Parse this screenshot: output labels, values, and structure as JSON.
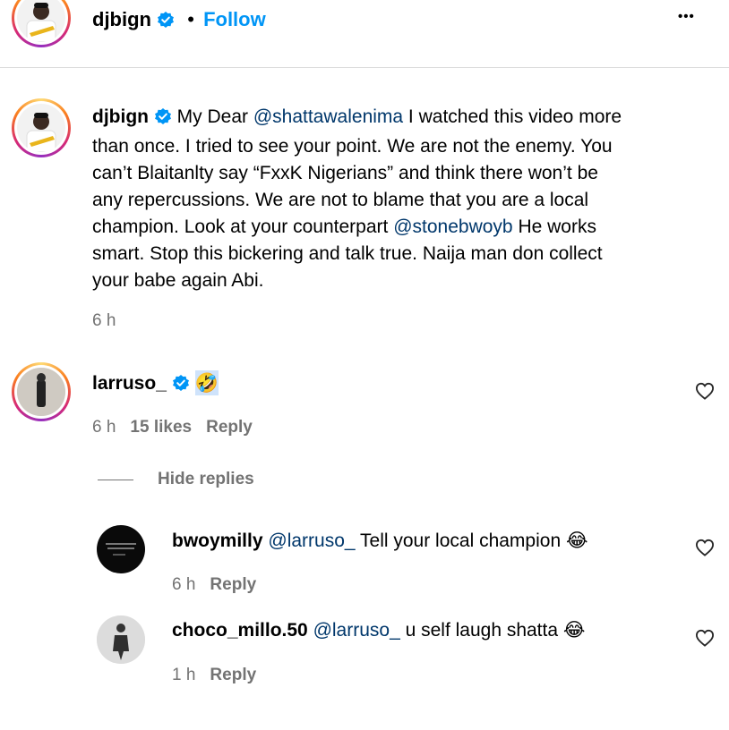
{
  "header": {
    "username": "djbign",
    "separator": "•",
    "follow_label": "Follow",
    "more_label": "•••"
  },
  "caption": {
    "username": "djbign",
    "lines": [
      [
        "My Dear ",
        "@shattawalenima",
        " I watched this video more"
      ],
      [
        "than once. I tried to see your point. We are not the enemy. You"
      ],
      [
        "can’t Blaitanlty say “FxxK Nigerians” and think there won’t be"
      ],
      [
        "any repercussions. We are not to blame that you are a local"
      ],
      [
        "champion. Look at your counterpart ",
        "@stonebwoyb",
        " He works"
      ],
      [
        "smart. Stop this bickering and talk true. Naija man don collect"
      ],
      [
        "your babe again Abi."
      ]
    ],
    "mention_1": "@shattawalenima",
    "mention_2": "@stonebwoyb",
    "time": "6 h"
  },
  "comment": {
    "username": "larruso_",
    "emoji": "🤣",
    "time": "6 h",
    "likes": "15 likes",
    "reply_label": "Reply",
    "hide_replies_label": "Hide replies"
  },
  "replies": [
    {
      "username": "bwoymilly",
      "mention": "@larruso_",
      "text": " Tell your local champion ",
      "emoji": "😂",
      "time": "6 h",
      "reply_label": "Reply"
    },
    {
      "username": "choco_millo.50",
      "mention": "@larruso_",
      "text": " u self laugh shatta ",
      "emoji": "😂",
      "time": "1 h",
      "reply_label": "Reply"
    }
  ],
  "colors": {
    "link_blue": "#0095f6",
    "mention_blue": "#00376b",
    "verified_blue": "#0095f6",
    "meta_gray": "#737373"
  },
  "icons": [
    "verified-badge-icon",
    "heart-icon",
    "more-options-icon"
  ]
}
